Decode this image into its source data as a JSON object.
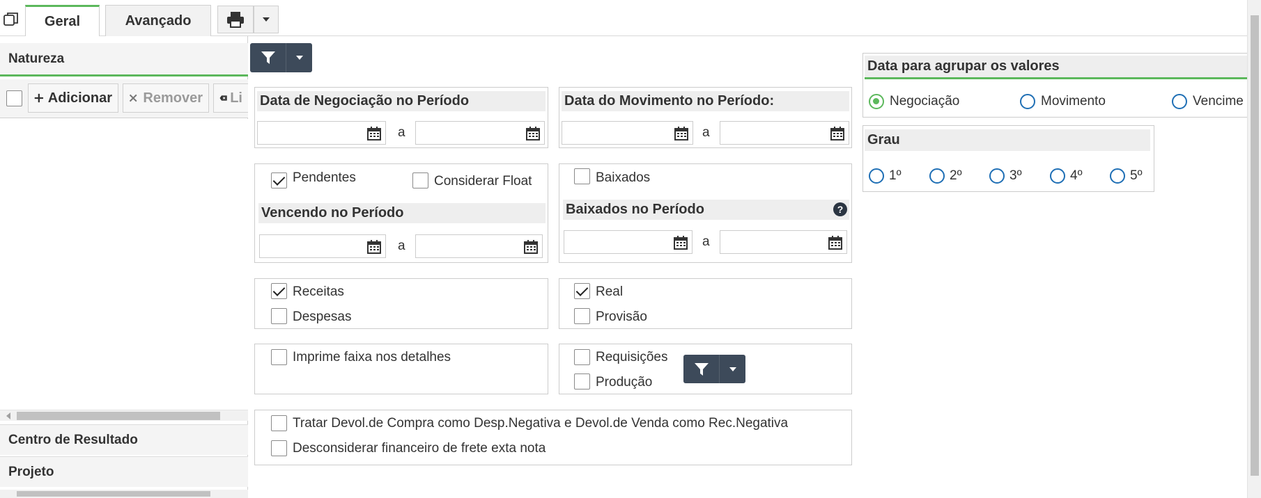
{
  "tabs": [
    {
      "label": "Geral",
      "active": true
    },
    {
      "label": "Avançado",
      "active": false
    }
  ],
  "left_panel": {
    "natureza_title": "Natureza",
    "add_label": "Adicionar",
    "remove_label": "Remover",
    "clear_label_visible": "Li",
    "centro_title": "Centro de Resultado",
    "projeto_title": "Projeto"
  },
  "negociacao": {
    "title": "Data de Negociação no Período",
    "start_value": "",
    "end_value": "",
    "sep": "a"
  },
  "movimento": {
    "title": "Data do Movimento no Período:",
    "start_value": "",
    "end_value": "",
    "sep": "a"
  },
  "pendentes": {
    "pendentes_label": "Pendentes",
    "pendentes_checked": true,
    "float_label": "Considerar Float",
    "float_checked": false,
    "title": "Vencendo no Período",
    "sep": "a"
  },
  "baixados": {
    "baixados_label": "Baixados",
    "baixados_checked": false,
    "title": "Baixados no Período",
    "sep": "a"
  },
  "tipo": {
    "receitas_label": "Receitas",
    "receitas_checked": true,
    "despesas_label": "Despesas",
    "despesas_checked": false
  },
  "realprov": {
    "real_label": "Real",
    "real_checked": true,
    "provisao_label": "Provisão",
    "provisao_checked": false
  },
  "faixa": {
    "label": "Imprime faixa nos detalhes",
    "checked": false
  },
  "reqprod": {
    "req_label": "Requisições",
    "req_checked": false,
    "prod_label": "Produção",
    "prod_checked": false
  },
  "devol": {
    "tratar_label": "Tratar Devol.de Compra como Desp.Negativa e Devol.de Venda como Rec.Negativa",
    "tratar_checked": false,
    "frete_label": "Desconsiderar financeiro de frete exta nota",
    "frete_checked": false
  },
  "agrupar": {
    "title": "Data para agrupar os valores",
    "options": [
      "Negociação",
      "Movimento",
      "Vencime"
    ],
    "selected": "Negociação"
  },
  "grau": {
    "title": "Grau",
    "options": [
      "1º",
      "2º",
      "3º",
      "4º",
      "5º"
    ]
  },
  "colors": {
    "accent_green": "#5cb85c",
    "dark_button": "#3d4a5a",
    "radio_blue": "#1f6fb5"
  }
}
